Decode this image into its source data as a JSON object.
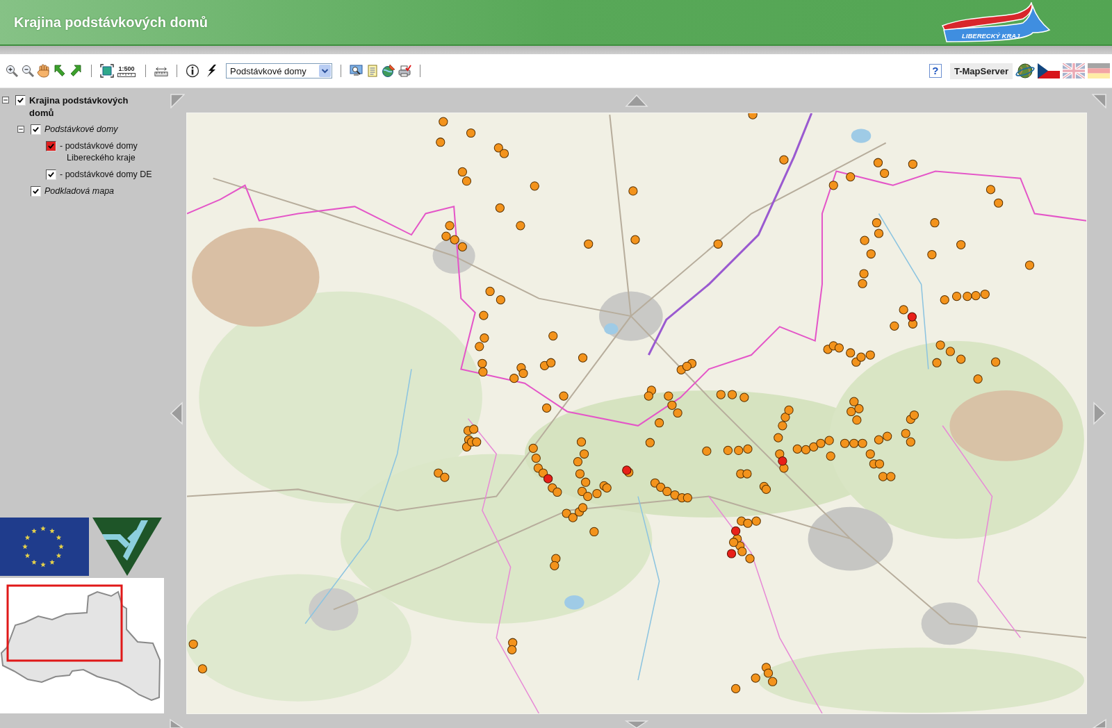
{
  "header": {
    "title": "Krajina podstávkových domů",
    "logo_text": "LIBERECKÝ KRAJ"
  },
  "toolbar": {
    "scale_label": "1:500",
    "layer_select": {
      "value": "Podstávkové domy"
    },
    "help_glyph": "?",
    "server_label": "T-MapServer",
    "languages": [
      {
        "selected": true
      },
      {
        "selected": false
      },
      {
        "selected": false
      }
    ]
  },
  "layer_tree": [
    {
      "kind": "group",
      "label": "Krajina podstávkových domů",
      "expanded": true,
      "checked": true,
      "children": [
        {
          "kind": "group",
          "label": "Podstávkové domy",
          "expanded": true,
          "checked": true,
          "children": [
            {
              "kind": "legend",
              "label": "- podstávkové domy Libereckého kraje",
              "checked": true,
              "color": "#e02020"
            },
            {
              "kind": "legend",
              "label": "- podstávkové domy DE",
              "checked": true,
              "color": "#ffffff"
            }
          ]
        },
        {
          "kind": "layer",
          "label": "Podkladová mapa",
          "checked": true
        }
      ]
    }
  ]
}
